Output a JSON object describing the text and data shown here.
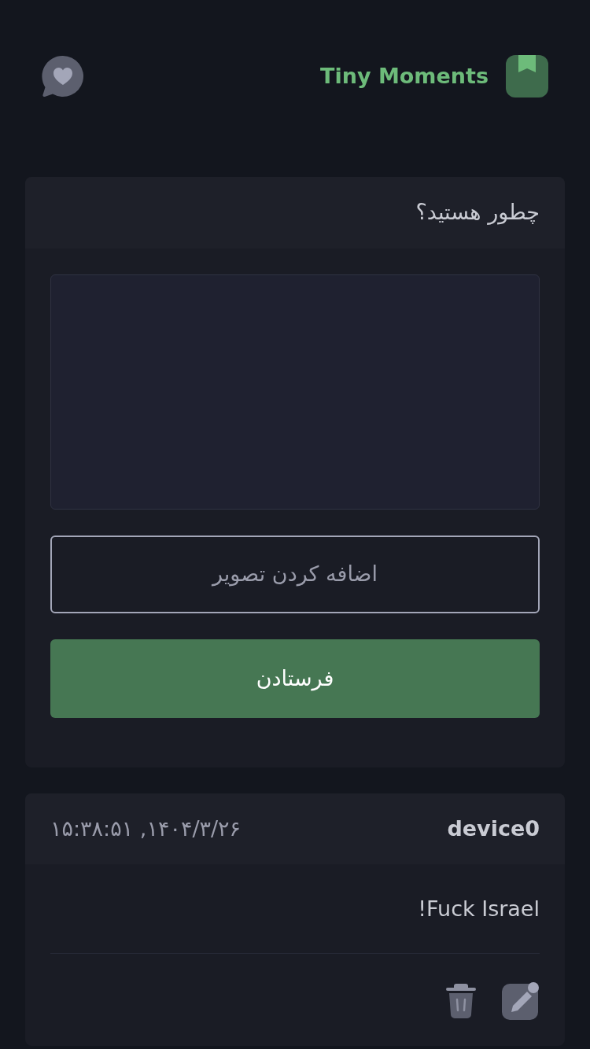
{
  "header": {
    "title": "Tiny Moments"
  },
  "composer": {
    "title": "چطور هستید؟",
    "add_image": "اضافه کردن تصویر",
    "submit": "فرستادن"
  },
  "posts": [
    {
      "author": "device0",
      "time": "۱۴۰۴/۳/۲۶, ۱۵:۳۸:۵۱",
      "text": "Fuck Israel!"
    }
  ]
}
